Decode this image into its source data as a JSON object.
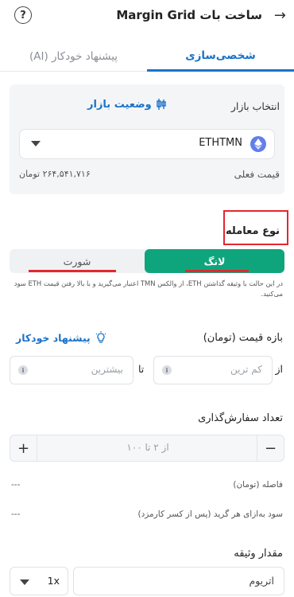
{
  "header": {
    "title": "ساخت بات Margin Grid",
    "help_icon": "?"
  },
  "tabs": {
    "custom": "شخصی‌سازی",
    "ai": "پیشنهاد خودکار (AI)"
  },
  "market": {
    "label": "انتخاب بازار",
    "status_link": "وضعیت بازار",
    "pair": "ETHTMN",
    "current_price_label": "قیمت فعلی",
    "current_price_value": "۲۶۴,۵۴۱,۷۱۶ تومان"
  },
  "trade_type": {
    "label": "نوع معامله",
    "long": "لانگ",
    "short": "شورت",
    "selected": "long",
    "note": "در این حالت با وثیقه گذاشتن ETH، از والکس TMN اعتبار می‌گیرید و با بالا رفتن قیمت ETH سود می‌کنید."
  },
  "price_range": {
    "label": "بازه قیمت (تومان)",
    "auto_suggest": "پیشنهاد خودکار",
    "from_label": "از",
    "to_label": "تا",
    "min_placeholder": "کم ترین",
    "max_placeholder": "بیشترین"
  },
  "orders": {
    "label": "تعداد سفارش‌گذاری",
    "placeholder": "از ۲ تا ۱۰۰",
    "minus": "−",
    "plus": "+"
  },
  "stats": {
    "spacing_label": "فاصله (تومان)",
    "spacing_value": "---",
    "profit_label": "سود به‌ازای هر گرید (پس از کسر کارمزد)",
    "profit_value": "---"
  },
  "collateral": {
    "label": "مقدار وثیقه",
    "asset": "اتریوم",
    "leverage": "1x"
  },
  "colors": {
    "accent_blue": "#1a73c9",
    "long_green": "#0fa57c",
    "highlight_red": "#e3262e"
  }
}
